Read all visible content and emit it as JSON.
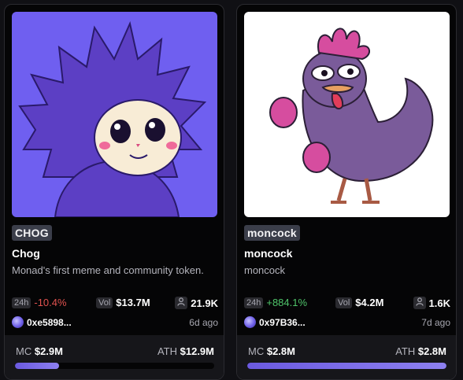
{
  "cards": [
    {
      "ticker": "CHOG",
      "name": "Chog",
      "description": "Monad's first meme and community token.",
      "change_period": "24h",
      "change": "-10.4%",
      "change_direction": "down",
      "vol_label": "Vol",
      "volume": "$13.7M",
      "holders": "21.9K",
      "creator": "0xe5898...",
      "age": "6d ago",
      "mc_label": "MC",
      "mc": "$2.9M",
      "ath_label": "ATH",
      "ath": "$12.9M",
      "progress": 0.22,
      "art_bg": "#6f5ff0"
    },
    {
      "ticker": "moncock",
      "name": "moncock",
      "description": "moncock",
      "change_period": "24h",
      "change": "+884.1%",
      "change_direction": "up",
      "vol_label": "Vol",
      "volume": "$4.2M",
      "holders": "1.6K",
      "creator": "0x97B36...",
      "age": "7d ago",
      "mc_label": "MC",
      "mc": "$2.8M",
      "ath_label": "ATH",
      "ath": "$2.8M",
      "progress": 1.0,
      "art_bg": "#ffffff"
    }
  ],
  "colors": {
    "accent": "#7b6bf0",
    "negative": "#e0524f",
    "positive": "#4fc46a"
  }
}
